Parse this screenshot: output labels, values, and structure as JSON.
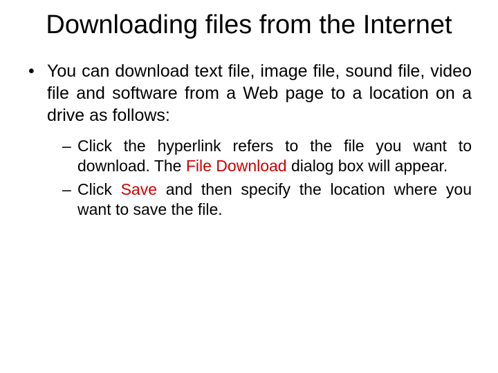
{
  "title": "Downloading files from the Internet",
  "main_bullet": "You can download text file, image file, sound file, video file and software from a Web page to a location on a drive as follows:",
  "sub_bullets": [
    {
      "prefix": "Click the hyperlink refers to the file you want to download. The ",
      "highlight": "File Download",
      "suffix": " dialog box will appear."
    },
    {
      "prefix": "Click ",
      "highlight": "Save",
      "suffix": " and then specify the location where you want to save the file."
    }
  ]
}
